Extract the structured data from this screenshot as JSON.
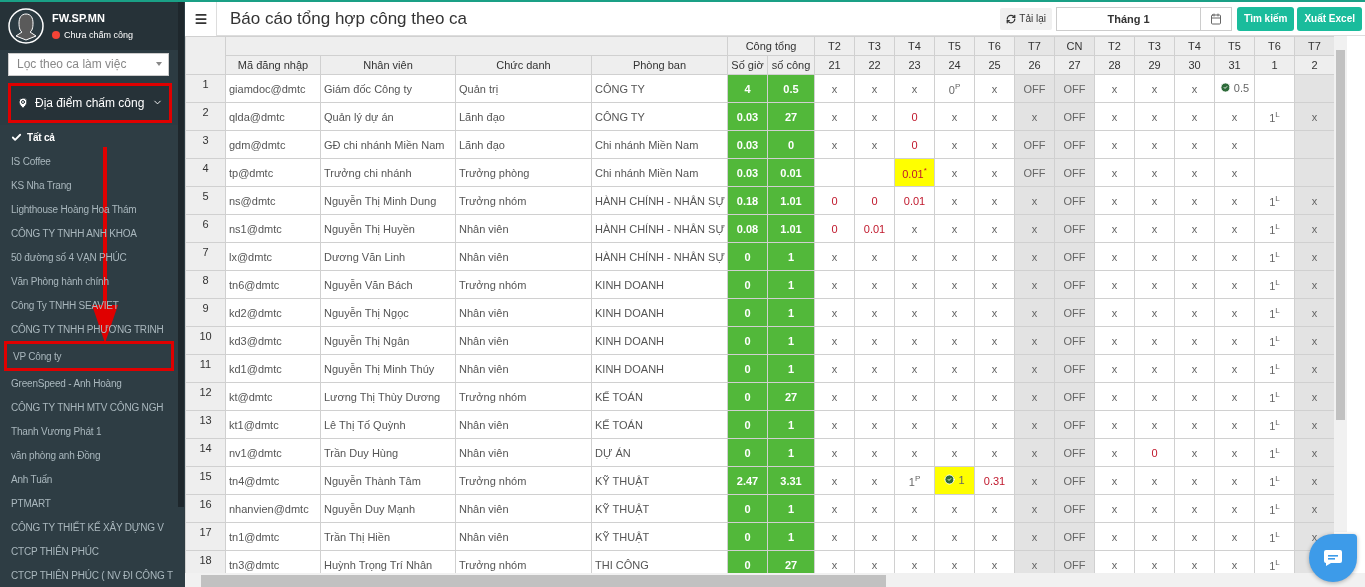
{
  "sidebar": {
    "user": {
      "name": "FW.SP.MN",
      "status": "Chưa chấm công"
    },
    "shift_filter": {
      "placeholder": "Lọc theo ca làm việc"
    },
    "location_dropdown": {
      "label": "Địa điểm chấm công",
      "expanded": true,
      "annotated": true
    },
    "annotation_arrow": true,
    "locations": [
      {
        "label": "Tất cả",
        "selected": true,
        "annotated": false
      },
      {
        "label": "IS Coffee",
        "selected": false,
        "annotated": false
      },
      {
        "label": "KS Nha Trang",
        "selected": false,
        "annotated": false
      },
      {
        "label": "Lighthouse Hoàng Hoa Thám",
        "selected": false,
        "annotated": false
      },
      {
        "label": "CÔNG TY TNHH ANH KHOA",
        "selected": false,
        "annotated": false
      },
      {
        "label": "50 đường số 4 VẠN PHÚC",
        "selected": false,
        "annotated": false
      },
      {
        "label": "Văn Phòng hành chính",
        "selected": false,
        "annotated": false
      },
      {
        "label": "Công Ty TNHH SEAVIET",
        "selected": false,
        "annotated": false
      },
      {
        "label": "CÔNG TY TNHH PHƯƠNG TRINH",
        "selected": false,
        "annotated": false
      },
      {
        "label": "VP Công ty",
        "selected": false,
        "annotated": true
      },
      {
        "label": "GreenSpeed - Anh Hoàng",
        "selected": false,
        "annotated": false
      },
      {
        "label": "CÔNG TY TNHH MTV CÔNG NGH",
        "selected": false,
        "annotated": false
      },
      {
        "label": "Thanh Vương Phát 1",
        "selected": false,
        "annotated": false
      },
      {
        "label": "văn phòng anh Đồng",
        "selected": false,
        "annotated": false
      },
      {
        "label": "Anh Tuấn",
        "selected": false,
        "annotated": false
      },
      {
        "label": "PTMART",
        "selected": false,
        "annotated": false
      },
      {
        "label": "CÔNG TY THIẾT KẾ XÂY DỰNG V",
        "selected": false,
        "annotated": false
      },
      {
        "label": "CTCP THIÊN PHÚC",
        "selected": false,
        "annotated": false
      },
      {
        "label": "CTCP THIÊN PHÚC ( NV ĐI CÔNG T",
        "selected": false,
        "annotated": false
      }
    ]
  },
  "header": {
    "title": "Báo cáo tổng hợp công theo ca",
    "reload_button": "Tải lại",
    "month_field": "Tháng 1",
    "search_button": "Tìm kiếm",
    "export_button": "Xuất Excel"
  },
  "table": {
    "info_columns": [
      "Mã đăng nhập",
      "Nhân viên",
      "Chức danh",
      "Phòng ban"
    ],
    "total_group": "Công tổng",
    "total_columns": [
      "Số giờ",
      "số công"
    ],
    "days": [
      {
        "weekday": "T2",
        "date": "21",
        "weekend": false
      },
      {
        "weekday": "T3",
        "date": "22",
        "weekend": false
      },
      {
        "weekday": "T4",
        "date": "23",
        "weekend": false
      },
      {
        "weekday": "T5",
        "date": "24",
        "weekend": false
      },
      {
        "weekday": "T6",
        "date": "25",
        "weekend": false
      },
      {
        "weekday": "T7",
        "date": "26",
        "weekend": true
      },
      {
        "weekday": "CN",
        "date": "27",
        "weekend": true
      },
      {
        "weekday": "T2",
        "date": "28",
        "weekend": false
      },
      {
        "weekday": "T3",
        "date": "29",
        "weekend": false
      },
      {
        "weekday": "T4",
        "date": "30",
        "weekend": false
      },
      {
        "weekday": "T5",
        "date": "31",
        "weekend": false
      },
      {
        "weekday": "T6",
        "date": "1",
        "weekend": false
      },
      {
        "weekday": "T7",
        "date": "2",
        "weekend": true
      }
    ],
    "rows": [
      {
        "no": "1",
        "login": "giamdoc@dmtc",
        "name": "Giám đốc Công ty",
        "title": "Quản trị",
        "department": "CÔNG TY",
        "hours": "4",
        "workdays": "0.5",
        "cells": [
          {
            "kind": "plain",
            "text": "x"
          },
          {
            "kind": "plain",
            "text": "x"
          },
          {
            "kind": "plain",
            "text": "x"
          },
          {
            "kind": "plain",
            "text": "0$^{P}$"
          },
          {
            "kind": "plain",
            "text": "x"
          },
          {
            "kind": "plain",
            "text": "OFF"
          },
          {
            "kind": "plain",
            "text": "OFF"
          },
          {
            "kind": "plain",
            "text": "x"
          },
          {
            "kind": "plain",
            "text": "x"
          },
          {
            "kind": "plain",
            "text": "x"
          },
          {
            "kind": "approved",
            "text": "0.5"
          },
          {
            "kind": "blank"
          },
          {
            "kind": "blank"
          }
        ]
      },
      {
        "no": "2",
        "login": "qlda@dmtc",
        "name": "Quản lý dự án",
        "title": "Lãnh đạo",
        "department": "CÔNG TY",
        "hours": "0.03",
        "workdays": "27",
        "cells": [
          {
            "kind": "plain",
            "text": "x"
          },
          {
            "kind": "plain",
            "text": "x"
          },
          {
            "kind": "alert",
            "text": "0"
          },
          {
            "kind": "plain",
            "text": "x"
          },
          {
            "kind": "plain",
            "text": "x"
          },
          {
            "kind": "plain",
            "text": "x"
          },
          {
            "kind": "plain",
            "text": "OFF"
          },
          {
            "kind": "plain",
            "text": "x"
          },
          {
            "kind": "plain",
            "text": "x"
          },
          {
            "kind": "plain",
            "text": "x"
          },
          {
            "kind": "plain",
            "text": "x"
          },
          {
            "kind": "plain",
            "text": "1$^{L}$"
          },
          {
            "kind": "plain",
            "text": "x"
          }
        ]
      },
      {
        "no": "3",
        "login": "gdm@dmtc",
        "name": "GĐ chi nhánh Miền Nam",
        "title": "Lãnh đạo",
        "department": "Chi nhánh Miền Nam",
        "hours": "0.03",
        "workdays": "0",
        "cells": [
          {
            "kind": "plain",
            "text": "x"
          },
          {
            "kind": "plain",
            "text": "x"
          },
          {
            "kind": "alert",
            "text": "0"
          },
          {
            "kind": "plain",
            "text": "x"
          },
          {
            "kind": "plain",
            "text": "x"
          },
          {
            "kind": "plain",
            "text": "OFF"
          },
          {
            "kind": "plain",
            "text": "OFF"
          },
          {
            "kind": "plain",
            "text": "x"
          },
          {
            "kind": "plain",
            "text": "x"
          },
          {
            "kind": "plain",
            "text": "x"
          },
          {
            "kind": "plain",
            "text": "x"
          },
          {
            "kind": "blank"
          },
          {
            "kind": "blank"
          }
        ]
      },
      {
        "no": "4",
        "login": "tp@dmtc",
        "name": "Trưởng chi nhánh",
        "title": "Trưởng phòng",
        "department": "Chi nhánh Miền Nam",
        "hours": "0.03",
        "workdays": "0.01",
        "cells": [
          {
            "kind": "blank"
          },
          {
            "kind": "blank"
          },
          {
            "kind": "marked",
            "text": "0.01$^{*}$"
          },
          {
            "kind": "plain",
            "text": "x"
          },
          {
            "kind": "plain",
            "text": "x"
          },
          {
            "kind": "plain",
            "text": "OFF"
          },
          {
            "kind": "plain",
            "text": "OFF"
          },
          {
            "kind": "plain",
            "text": "x"
          },
          {
            "kind": "plain",
            "text": "x"
          },
          {
            "kind": "plain",
            "text": "x"
          },
          {
            "kind": "plain",
            "text": "x"
          },
          {
            "kind": "blank"
          },
          {
            "kind": "blank"
          }
        ]
      },
      {
        "no": "5",
        "login": "ns@dmtc",
        "name": "Nguyễn Thị Minh Dung",
        "title": "Trưởng nhóm",
        "department": "HÀNH CHÍNH - NHÂN SỰ",
        "hours": "0.18",
        "workdays": "1.01",
        "cells": [
          {
            "kind": "alert",
            "text": "0"
          },
          {
            "kind": "alert",
            "text": "0"
          },
          {
            "kind": "alert",
            "text": "0.01"
          },
          {
            "kind": "plain",
            "text": "x"
          },
          {
            "kind": "plain",
            "text": "x"
          },
          {
            "kind": "plain",
            "text": "x"
          },
          {
            "kind": "plain",
            "text": "OFF"
          },
          {
            "kind": "plain",
            "text": "x"
          },
          {
            "kind": "plain",
            "text": "x"
          },
          {
            "kind": "plain",
            "text": "x"
          },
          {
            "kind": "plain",
            "text": "x"
          },
          {
            "kind": "plain",
            "text": "1$^{L}$"
          },
          {
            "kind": "plain",
            "text": "x"
          }
        ]
      },
      {
        "no": "6",
        "login": "ns1@dmtc",
        "name": "Nguyễn Thị Huyền",
        "title": "Nhân viên",
        "department": "HÀNH CHÍNH - NHÂN SỰ",
        "hours": "0.08",
        "workdays": "1.01",
        "cells": [
          {
            "kind": "alert",
            "text": "0"
          },
          {
            "kind": "alert",
            "text": "0.01"
          },
          {
            "kind": "plain",
            "text": "x"
          },
          {
            "kind": "plain",
            "text": "x"
          },
          {
            "kind": "plain",
            "text": "x"
          },
          {
            "kind": "plain",
            "text": "x"
          },
          {
            "kind": "plain",
            "text": "OFF"
          },
          {
            "kind": "plain",
            "text": "x"
          },
          {
            "kind": "plain",
            "text": "x"
          },
          {
            "kind": "plain",
            "text": "x"
          },
          {
            "kind": "plain",
            "text": "x"
          },
          {
            "kind": "plain",
            "text": "1$^{L}$"
          },
          {
            "kind": "plain",
            "text": "x"
          }
        ]
      },
      {
        "no": "7",
        "login": "lx@dmtc",
        "name": "Dương Văn Linh",
        "title": "Nhân viên",
        "department": "HÀNH CHÍNH - NHÂN SỰ",
        "hours": "0",
        "workdays": "1",
        "cells": [
          {
            "kind": "plain",
            "text": "x"
          },
          {
            "kind": "plain",
            "text": "x"
          },
          {
            "kind": "plain",
            "text": "x"
          },
          {
            "kind": "plain",
            "text": "x"
          },
          {
            "kind": "plain",
            "text": "x"
          },
          {
            "kind": "plain",
            "text": "x"
          },
          {
            "kind": "plain",
            "text": "OFF"
          },
          {
            "kind": "plain",
            "text": "x"
          },
          {
            "kind": "plain",
            "text": "x"
          },
          {
            "kind": "plain",
            "text": "x"
          },
          {
            "kind": "plain",
            "text": "x"
          },
          {
            "kind": "plain",
            "text": "1$^{L}$"
          },
          {
            "kind": "plain",
            "text": "x"
          }
        ]
      },
      {
        "no": "8",
        "login": "tn6@dmtc",
        "name": "Nguyễn Văn Bách",
        "title": "Trưởng nhóm",
        "department": "KINH DOANH",
        "hours": "0",
        "workdays": "1",
        "cells": [
          {
            "kind": "plain",
            "text": "x"
          },
          {
            "kind": "plain",
            "text": "x"
          },
          {
            "kind": "plain",
            "text": "x"
          },
          {
            "kind": "plain",
            "text": "x"
          },
          {
            "kind": "plain",
            "text": "x"
          },
          {
            "kind": "plain",
            "text": "x"
          },
          {
            "kind": "plain",
            "text": "OFF"
          },
          {
            "kind": "plain",
            "text": "x"
          },
          {
            "kind": "plain",
            "text": "x"
          },
          {
            "kind": "plain",
            "text": "x"
          },
          {
            "kind": "plain",
            "text": "x"
          },
          {
            "kind": "plain",
            "text": "1$^{L}$"
          },
          {
            "kind": "plain",
            "text": "x"
          }
        ]
      },
      {
        "no": "9",
        "login": "kd2@dmtc",
        "name": "Nguyễn Thị Ngọc",
        "title": "Nhân viên",
        "department": "KINH DOANH",
        "hours": "0",
        "workdays": "1",
        "cells": [
          {
            "kind": "plain",
            "text": "x"
          },
          {
            "kind": "plain",
            "text": "x"
          },
          {
            "kind": "plain",
            "text": "x"
          },
          {
            "kind": "plain",
            "text": "x"
          },
          {
            "kind": "plain",
            "text": "x"
          },
          {
            "kind": "plain",
            "text": "x"
          },
          {
            "kind": "plain",
            "text": "OFF"
          },
          {
            "kind": "plain",
            "text": "x"
          },
          {
            "kind": "plain",
            "text": "x"
          },
          {
            "kind": "plain",
            "text": "x"
          },
          {
            "kind": "plain",
            "text": "x"
          },
          {
            "kind": "plain",
            "text": "1$^{L}$"
          },
          {
            "kind": "plain",
            "text": "x"
          }
        ]
      },
      {
        "no": "10",
        "login": "kd3@dmtc",
        "name": "Nguyễn Thị Ngân",
        "title": "Nhân viên",
        "department": "KINH DOANH",
        "hours": "0",
        "workdays": "1",
        "cells": [
          {
            "kind": "plain",
            "text": "x"
          },
          {
            "kind": "plain",
            "text": "x"
          },
          {
            "kind": "plain",
            "text": "x"
          },
          {
            "kind": "plain",
            "text": "x"
          },
          {
            "kind": "plain",
            "text": "x"
          },
          {
            "kind": "plain",
            "text": "x"
          },
          {
            "kind": "plain",
            "text": "OFF"
          },
          {
            "kind": "plain",
            "text": "x"
          },
          {
            "kind": "plain",
            "text": "x"
          },
          {
            "kind": "plain",
            "text": "x"
          },
          {
            "kind": "plain",
            "text": "x"
          },
          {
            "kind": "plain",
            "text": "1$^{L}$"
          },
          {
            "kind": "plain",
            "text": "x"
          }
        ]
      },
      {
        "no": "11",
        "login": "kd1@dmtc",
        "name": "Nguyễn Thị Minh Thúy",
        "title": "Nhân viên",
        "department": "KINH DOANH",
        "hours": "0",
        "workdays": "1",
        "cells": [
          {
            "kind": "plain",
            "text": "x"
          },
          {
            "kind": "plain",
            "text": "x"
          },
          {
            "kind": "plain",
            "text": "x"
          },
          {
            "kind": "plain",
            "text": "x"
          },
          {
            "kind": "plain",
            "text": "x"
          },
          {
            "kind": "plain",
            "text": "x"
          },
          {
            "kind": "plain",
            "text": "OFF"
          },
          {
            "kind": "plain",
            "text": "x"
          },
          {
            "kind": "plain",
            "text": "x"
          },
          {
            "kind": "plain",
            "text": "x"
          },
          {
            "kind": "plain",
            "text": "x"
          },
          {
            "kind": "plain",
            "text": "1$^{L}$"
          },
          {
            "kind": "plain",
            "text": "x"
          }
        ]
      },
      {
        "no": "12",
        "login": "kt@dmtc",
        "name": "Lương Thị Thùy Dương",
        "title": "Trưởng nhóm",
        "department": "KẾ TOÁN",
        "hours": "0",
        "workdays": "27",
        "cells": [
          {
            "kind": "plain",
            "text": "x"
          },
          {
            "kind": "plain",
            "text": "x"
          },
          {
            "kind": "plain",
            "text": "x"
          },
          {
            "kind": "plain",
            "text": "x"
          },
          {
            "kind": "plain",
            "text": "x"
          },
          {
            "kind": "plain",
            "text": "x"
          },
          {
            "kind": "plain",
            "text": "OFF"
          },
          {
            "kind": "plain",
            "text": "x"
          },
          {
            "kind": "plain",
            "text": "x"
          },
          {
            "kind": "plain",
            "text": "x"
          },
          {
            "kind": "plain",
            "text": "x"
          },
          {
            "kind": "plain",
            "text": "1$^{L}$"
          },
          {
            "kind": "plain",
            "text": "x"
          }
        ]
      },
      {
        "no": "13",
        "login": "kt1@dmtc",
        "name": "Lê Thị Tố Quỳnh",
        "title": "Nhân viên",
        "department": "KẾ TOÁN",
        "hours": "0",
        "workdays": "1",
        "cells": [
          {
            "kind": "plain",
            "text": "x"
          },
          {
            "kind": "plain",
            "text": "x"
          },
          {
            "kind": "plain",
            "text": "x"
          },
          {
            "kind": "plain",
            "text": "x"
          },
          {
            "kind": "plain",
            "text": "x"
          },
          {
            "kind": "plain",
            "text": "x"
          },
          {
            "kind": "plain",
            "text": "OFF"
          },
          {
            "kind": "plain",
            "text": "x"
          },
          {
            "kind": "plain",
            "text": "x"
          },
          {
            "kind": "plain",
            "text": "x"
          },
          {
            "kind": "plain",
            "text": "x"
          },
          {
            "kind": "plain",
            "text": "1$^{L}$"
          },
          {
            "kind": "plain",
            "text": "x"
          }
        ]
      },
      {
        "no": "14",
        "login": "nv1@dmtc",
        "name": "Trần Duy Hùng",
        "title": "Nhân viên",
        "department": "DỰ ÁN",
        "hours": "0",
        "workdays": "1",
        "cells": [
          {
            "kind": "plain",
            "text": "x"
          },
          {
            "kind": "plain",
            "text": "x"
          },
          {
            "kind": "plain",
            "text": "x"
          },
          {
            "kind": "plain",
            "text": "x"
          },
          {
            "kind": "plain",
            "text": "x"
          },
          {
            "kind": "plain",
            "text": "x"
          },
          {
            "kind": "plain",
            "text": "OFF"
          },
          {
            "kind": "plain",
            "text": "x"
          },
          {
            "kind": "alert",
            "text": "0"
          },
          {
            "kind": "plain",
            "text": "x"
          },
          {
            "kind": "plain",
            "text": "x"
          },
          {
            "kind": "plain",
            "text": "1$^{L}$"
          },
          {
            "kind": "plain",
            "text": "x"
          }
        ]
      },
      {
        "no": "15",
        "login": "tn4@dmtc",
        "name": "Nguyễn Thành Tâm",
        "title": "Trưởng nhóm",
        "department": "KỸ THUẬT",
        "hours": "2.47",
        "workdays": "3.31",
        "cells": [
          {
            "kind": "plain",
            "text": "x"
          },
          {
            "kind": "plain",
            "text": "x"
          },
          {
            "kind": "plain",
            "text": "1$^{P}$"
          },
          {
            "kind": "approved-marked",
            "text": "1"
          },
          {
            "kind": "alert",
            "text": "0.31"
          },
          {
            "kind": "plain",
            "text": "x"
          },
          {
            "kind": "plain",
            "text": "OFF"
          },
          {
            "kind": "plain",
            "text": "x"
          },
          {
            "kind": "plain",
            "text": "x"
          },
          {
            "kind": "plain",
            "text": "x"
          },
          {
            "kind": "plain",
            "text": "x"
          },
          {
            "kind": "plain",
            "text": "1$^{L}$"
          },
          {
            "kind": "plain",
            "text": "x"
          }
        ]
      },
      {
        "no": "16",
        "login": "nhanvien@dmtc",
        "name": "Nguyễn Duy Mạnh",
        "title": "Nhân viên",
        "department": "KỸ THUẬT",
        "hours": "0",
        "workdays": "1",
        "cells": [
          {
            "kind": "plain",
            "text": "x"
          },
          {
            "kind": "plain",
            "text": "x"
          },
          {
            "kind": "plain",
            "text": "x"
          },
          {
            "kind": "plain",
            "text": "x"
          },
          {
            "kind": "plain",
            "text": "x"
          },
          {
            "kind": "plain",
            "text": "x"
          },
          {
            "kind": "plain",
            "text": "OFF"
          },
          {
            "kind": "plain",
            "text": "x"
          },
          {
            "kind": "plain",
            "text": "x"
          },
          {
            "kind": "plain",
            "text": "x"
          },
          {
            "kind": "plain",
            "text": "x"
          },
          {
            "kind": "plain",
            "text": "1$^{L}$"
          },
          {
            "kind": "plain",
            "text": "x"
          }
        ]
      },
      {
        "no": "17",
        "login": "tn1@dmtc",
        "name": "Trần Thị Hiền",
        "title": "Nhân viên",
        "department": "KỸ THUẬT",
        "hours": "0",
        "workdays": "1",
        "cells": [
          {
            "kind": "plain",
            "text": "x"
          },
          {
            "kind": "plain",
            "text": "x"
          },
          {
            "kind": "plain",
            "text": "x"
          },
          {
            "kind": "plain",
            "text": "x"
          },
          {
            "kind": "plain",
            "text": "x"
          },
          {
            "kind": "plain",
            "text": "x"
          },
          {
            "kind": "plain",
            "text": "OFF"
          },
          {
            "kind": "plain",
            "text": "x"
          },
          {
            "kind": "plain",
            "text": "x"
          },
          {
            "kind": "plain",
            "text": "x"
          },
          {
            "kind": "plain",
            "text": "x"
          },
          {
            "kind": "plain",
            "text": "1$^{L}$"
          },
          {
            "kind": "plain",
            "text": "x"
          }
        ]
      },
      {
        "no": "18",
        "login": "tn3@dmtc",
        "name": "Huỳnh Trọng Trí Nhân",
        "title": "Trưởng nhóm",
        "department": "THI CÔNG",
        "hours": "0",
        "workdays": "27",
        "cells": [
          {
            "kind": "plain",
            "text": "x"
          },
          {
            "kind": "plain",
            "text": "x"
          },
          {
            "kind": "plain",
            "text": "x"
          },
          {
            "kind": "plain",
            "text": "x"
          },
          {
            "kind": "plain",
            "text": "x"
          },
          {
            "kind": "plain",
            "text": "x"
          },
          {
            "kind": "plain",
            "text": "OFF"
          },
          {
            "kind": "plain",
            "text": "x"
          },
          {
            "kind": "plain",
            "text": "x"
          },
          {
            "kind": "plain",
            "text": "x"
          },
          {
            "kind": "plain",
            "text": "x"
          },
          {
            "kind": "plain",
            "text": "1$^{L}$"
          },
          {
            "kind": "plain"
          }
        ]
      }
    ]
  }
}
